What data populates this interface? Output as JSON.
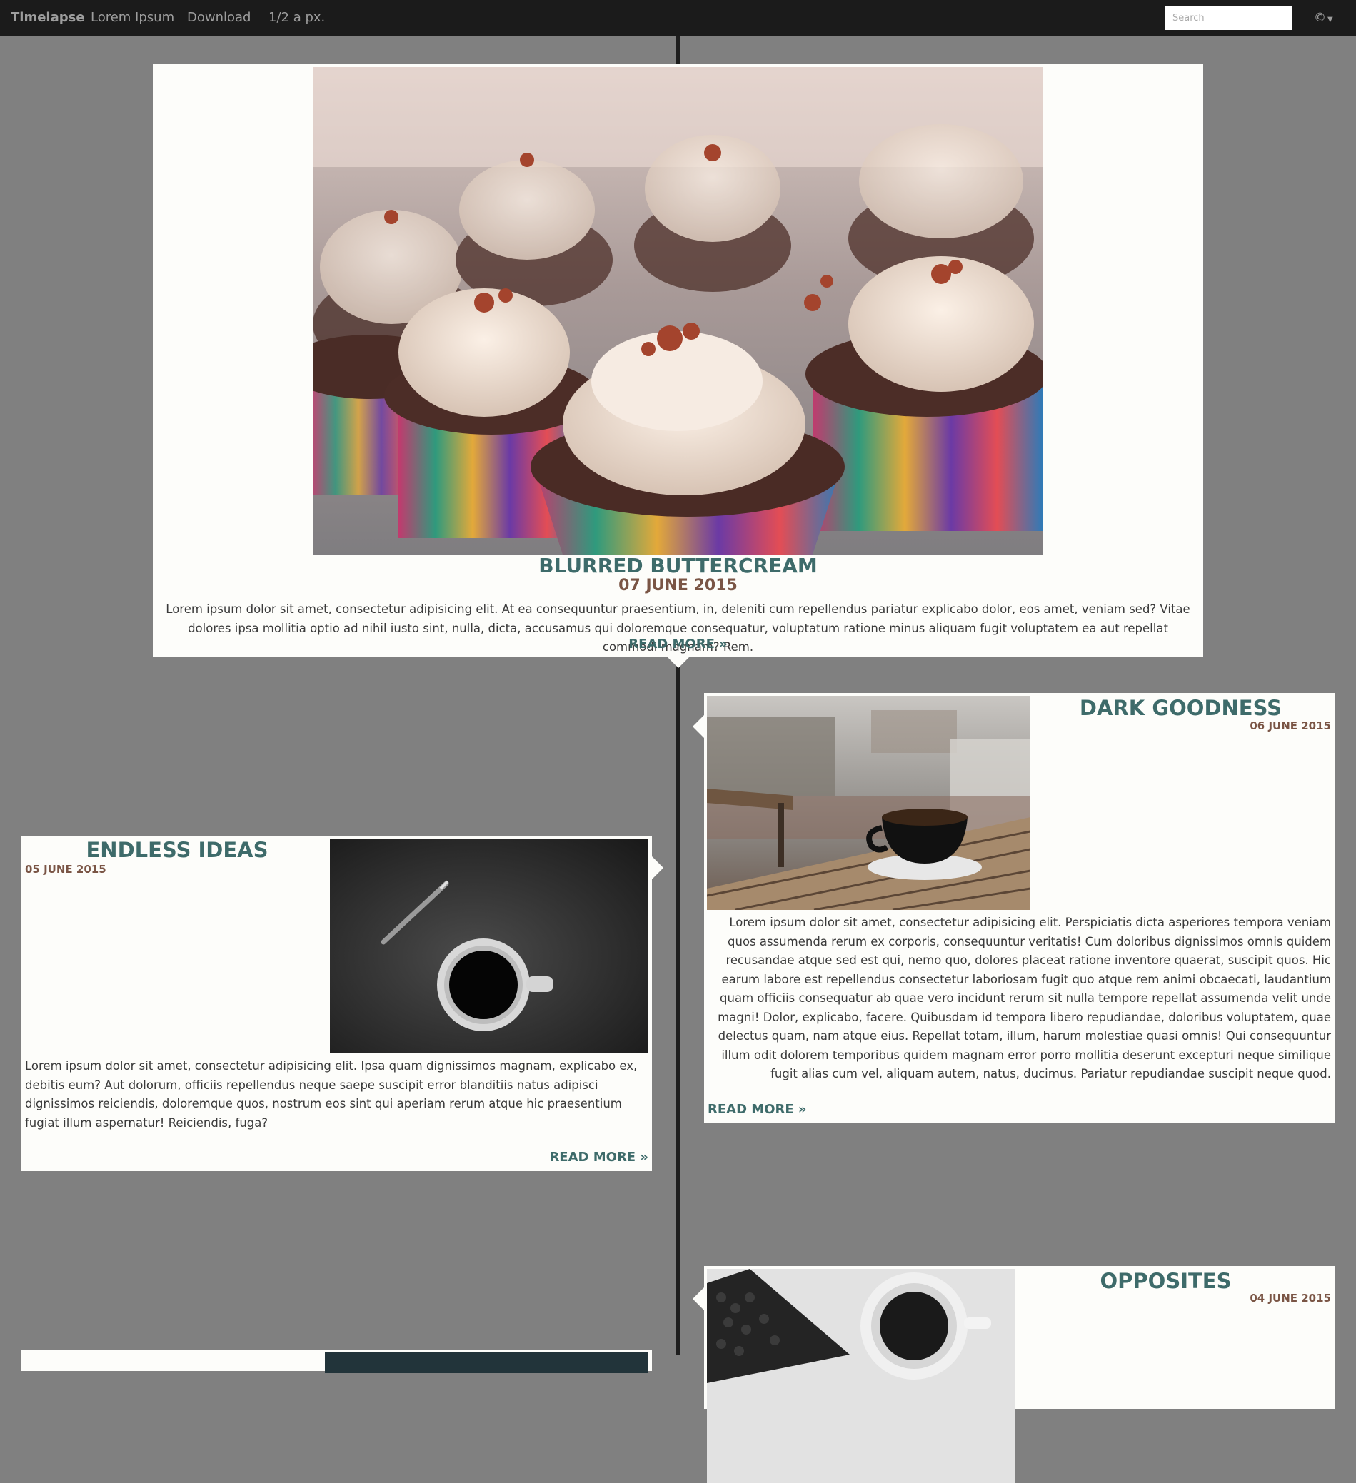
{
  "navbar": {
    "brand": "Timelapse",
    "links": [
      "Lorem Ipsum",
      "Download",
      "1/2 a px."
    ],
    "search_placeholder": "Search",
    "user_menu_label": "©"
  },
  "posts": [
    {
      "title": "BLURRED BUTTERCREAM",
      "date": "07 JUNE 2015",
      "text": "Lorem ipsum dolor sit amet, consectetur adipisicing elit. At ea consequuntur praesentium, in, deleniti cum repellendus pariatur explicabo dolor, eos amet, veniam sed? Vitae dolores ipsa mollitia optio ad nihil iusto sint, nulla, dicta, accusamus qui doloremque consequatur, voluptatum ratione minus aliquam fugit voluptatem ea aut repellat commodi magnam? Rem.",
      "read_more": "READ MORE »",
      "image": "cupcakes-photo"
    },
    {
      "title": "DARK GOODNESS",
      "date": "06 JUNE 2015",
      "text": "Lorem ipsum dolor sit amet, consectetur adipisicing elit. Perspiciatis dicta asperiores tempora veniam quos assumenda rerum ex corporis, consequuntur veritatis! Cum doloribus dignissimos omnis quidem recusandae atque sed est qui, nemo quo, dolores placeat ratione inventore quaerat, suscipit quos. Hic earum labore est repellendus consectetur laboriosam fugit quo atque rem animi obcaecati, laudantium quam officiis consequatur ab quae vero incidunt rerum sit nulla tempore repellat assumenda velit unde magni! Dolor, explicabo, facere. Quibusdam id tempora libero repudiandae, doloribus voluptatem, quae delectus quam, nam atque eius. Repellat totam, illum, harum molestiae quasi omnis! Qui consequuntur illum odit dolorem temporibus quidem magnam error porro mollitia deserunt excepturi neque similique fugit alias cum vel, aliquam autem, natus, ducimus. Pariatur repudiandae suscipit neque quod.",
      "read_more": "READ MORE »",
      "image": "coffee-cup-on-table-photo"
    },
    {
      "title": "ENDLESS IDEAS",
      "date": "05 JUNE 2015",
      "text": "Lorem ipsum dolor sit amet, consectetur adipisicing elit. Ipsa quam dignissimos magnam, explicabo ex, debitis eum? Aut dolorum, officiis repellendus neque saepe suscipit error blanditiis natus adipisci dignissimos reiciendis, doloremque quos, nostrum eos sint qui aperiam rerum atque hic praesentium fugiat illum aspernatur! Reiciendis, fuga?",
      "read_more": "READ MORE »",
      "image": "coffee-and-pencil-photo"
    },
    {
      "title": "OPPOSITES",
      "date": "04 JUNE 2015",
      "image": "coffee-beans-and-cup-photo"
    }
  ]
}
